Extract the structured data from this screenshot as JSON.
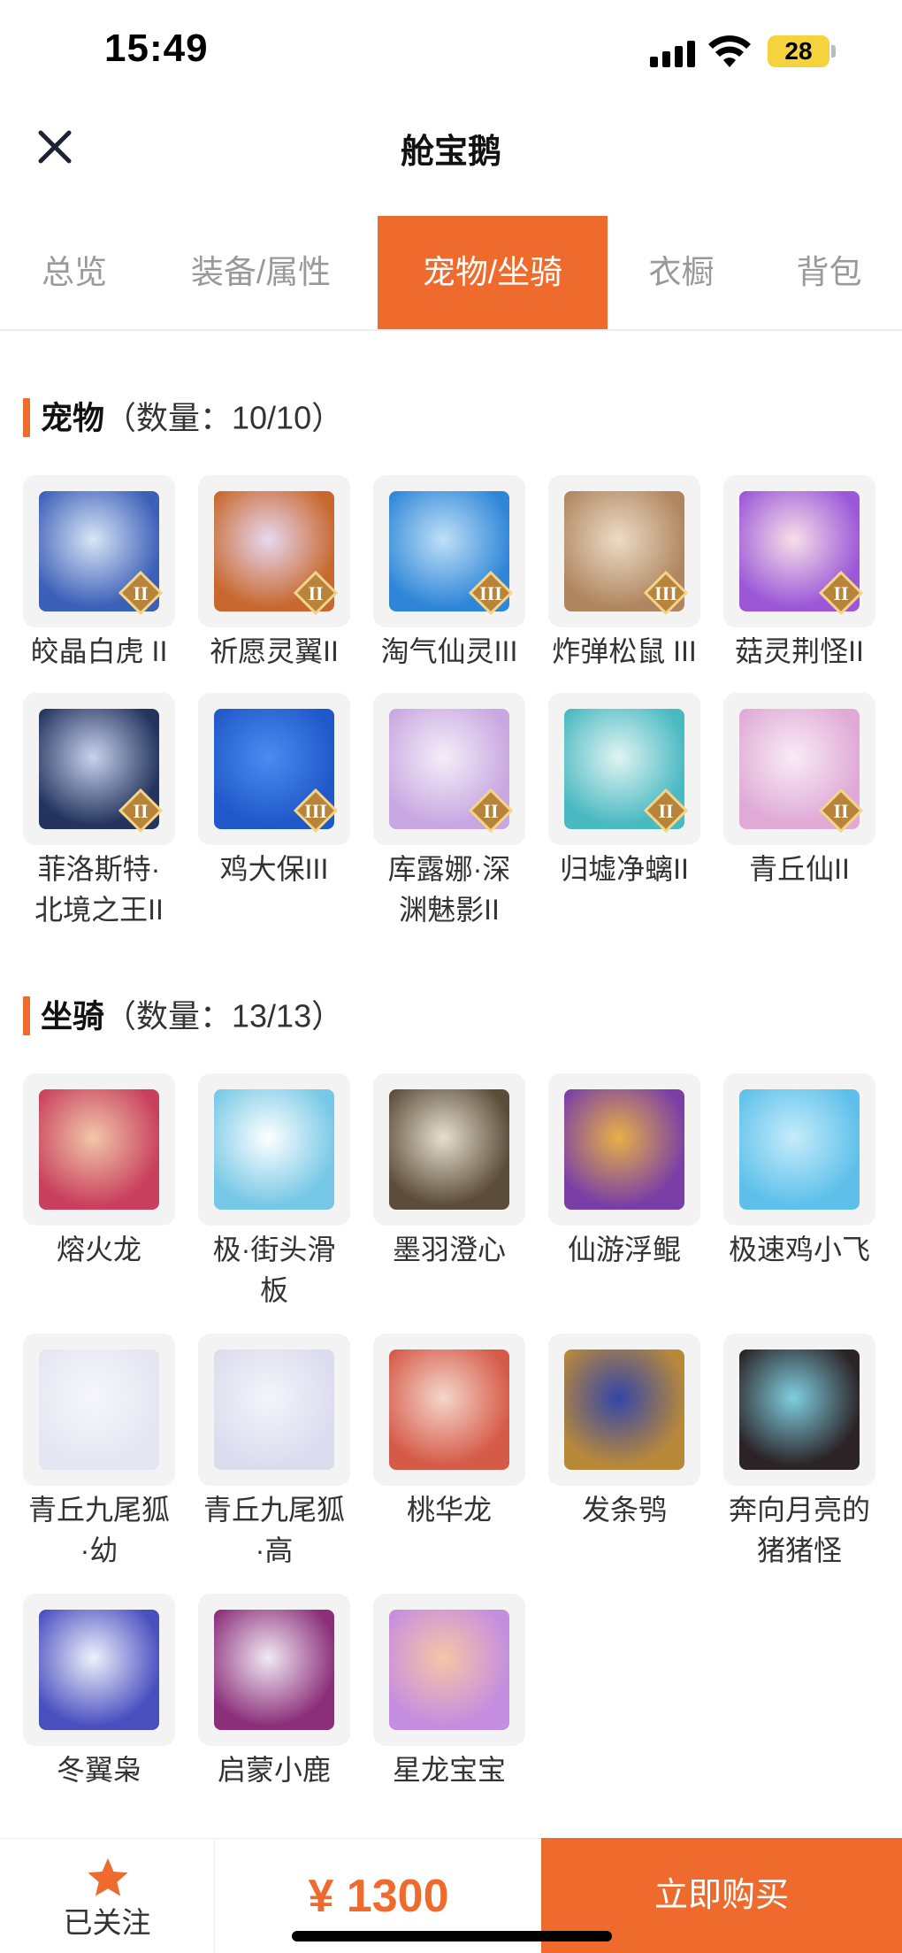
{
  "status": {
    "time": "15:49",
    "battery": "28"
  },
  "nav": {
    "title": "舱宝鹅"
  },
  "tabs": [
    {
      "label": "总览",
      "active": false
    },
    {
      "label": "装备/属性",
      "active": false
    },
    {
      "label": "宠物/坐骑",
      "active": true
    },
    {
      "label": "衣橱",
      "active": false
    },
    {
      "label": "背包",
      "active": false
    }
  ],
  "pets": {
    "title": "宠物",
    "count": "（数量：10/10）",
    "items": [
      {
        "name": "皎晶白虎 II",
        "tier": "II",
        "colors": [
          "#3c5fb8",
          "#d9e6f6"
        ]
      },
      {
        "name": "祈愿灵翼II",
        "tier": "II",
        "colors": [
          "#c8682e",
          "#e7d8f2"
        ]
      },
      {
        "name": "淘气仙灵III",
        "tier": "III",
        "colors": [
          "#2f86d8",
          "#bfe0f7"
        ]
      },
      {
        "name": "炸弹松鼠 III",
        "tier": "III",
        "colors": [
          "#b08660",
          "#ecdcc6"
        ]
      },
      {
        "name": "菇灵荆怪II",
        "tier": "II",
        "colors": [
          "#9b57d8",
          "#f7dfe8"
        ]
      },
      {
        "name": "菲洛斯特·\n北境之王II",
        "tier": "II",
        "colors": [
          "#24345e",
          "#c9d2ee"
        ]
      },
      {
        "name": "鸡大保III",
        "tier": "III",
        "colors": [
          "#1f58c9",
          "#4b8cf0"
        ]
      },
      {
        "name": "库露娜·深\n渊魅影II",
        "tier": "II",
        "colors": [
          "#c9a7e2",
          "#f4eef8"
        ]
      },
      {
        "name": "归墟净螭II",
        "tier": "II",
        "colors": [
          "#49b9c2",
          "#e1f4f2"
        ]
      },
      {
        "name": "青丘仙II",
        "tier": "II",
        "colors": [
          "#e0a9d6",
          "#f8ecf6"
        ]
      }
    ]
  },
  "mounts": {
    "title": "坐骑",
    "count": "（数量：13/13）",
    "items": [
      {
        "name": "熔火龙",
        "colors": [
          "#c9405e",
          "#f1c7a8"
        ]
      },
      {
        "name": "极·街头滑\n板",
        "colors": [
          "#77c8e6",
          "#ffffff"
        ]
      },
      {
        "name": "墨羽澄心",
        "colors": [
          "#5c4d3a",
          "#e6dfd0"
        ]
      },
      {
        "name": "仙游浮鲲",
        "colors": [
          "#7a3fa6",
          "#e7b046"
        ]
      },
      {
        "name": "极速鸡小飞",
        "colors": [
          "#5ec0ea",
          "#c5ecfb"
        ]
      },
      {
        "name": "青丘九尾狐\n·幼",
        "colors": [
          "#e6e6f2",
          "#f6f6fb"
        ]
      },
      {
        "name": "青丘九尾狐\n·高",
        "colors": [
          "#dcdcef",
          "#f4f4fa"
        ]
      },
      {
        "name": "桃华龙",
        "colors": [
          "#d65a48",
          "#f4d7cc"
        ]
      },
      {
        "name": "发条鸮",
        "colors": [
          "#b9893a",
          "#3346a8"
        ]
      },
      {
        "name": "奔向月亮的\n猪猪怪",
        "colors": [
          "#2b2326",
          "#7fcfe0"
        ]
      },
      {
        "name": "冬翼枭",
        "colors": [
          "#4a4fc0",
          "#eef2fb"
        ]
      },
      {
        "name": "启蒙小鹿",
        "colors": [
          "#8b2f7a",
          "#f1e9f4"
        ]
      },
      {
        "name": "星龙宝宝",
        "colors": [
          "#c48de0",
          "#f6c6a6"
        ]
      }
    ]
  },
  "bottom": {
    "follow_label": "已关注",
    "price": "¥ 1300",
    "buy_label": "立即购买",
    "accent": "#ee6a2d"
  }
}
